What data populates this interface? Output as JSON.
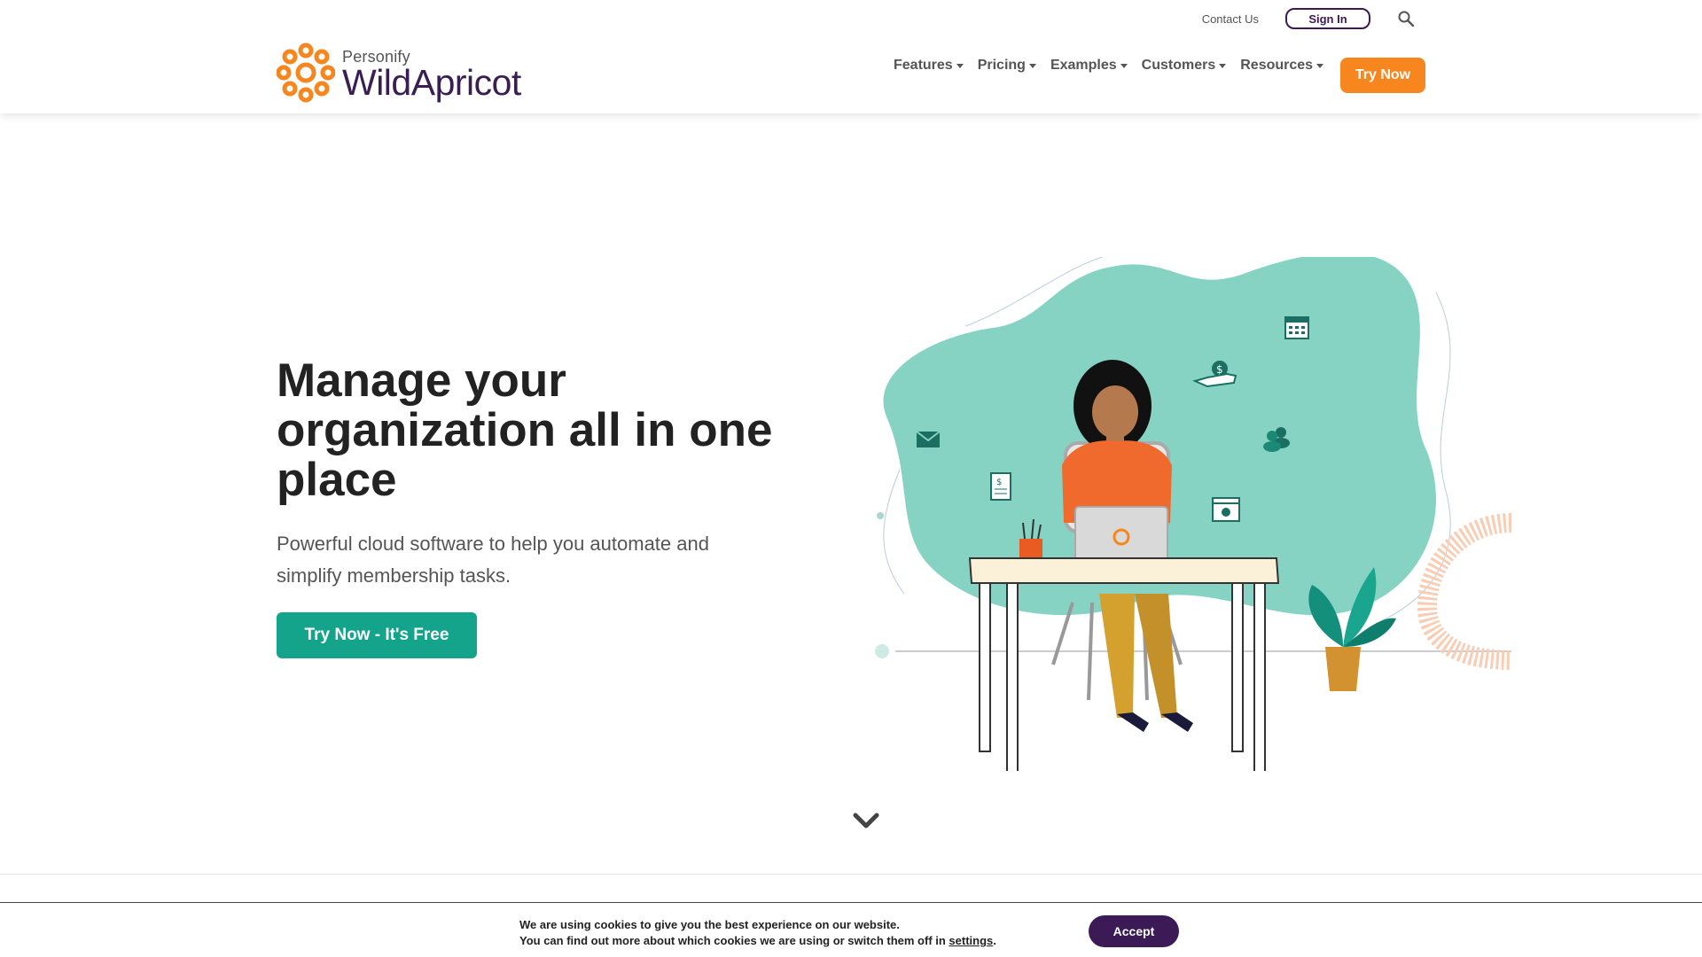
{
  "header": {
    "topbar": {
      "contact_label": "Contact Us",
      "signin_label": "Sign In",
      "search_icon": "search-icon"
    },
    "logo": {
      "personify": "Personify",
      "wordmark": "WildApricot"
    },
    "nav": {
      "items": [
        {
          "label": "Features"
        },
        {
          "label": "Pricing"
        },
        {
          "label": "Examples"
        },
        {
          "label": "Customers"
        },
        {
          "label": "Resources"
        }
      ],
      "cta_label": "Try Now"
    }
  },
  "hero": {
    "title": "Manage your organization all in one place",
    "subtitle": "Powerful cloud software to help you automate and simplify membership tasks.",
    "cta_label": "Try Now - It's Free"
  },
  "cookie": {
    "line1": "We are using cookies to give you the best experience on our website.",
    "line2_prefix": "You can find out more about which cookies we are using or switch them off in ",
    "settings_label": "settings",
    "line2_suffix": ".",
    "accept_label": "Accept"
  },
  "colors": {
    "brand_orange": "#f7861e",
    "brand_purple": "#3b1a55",
    "teal_cta": "#14a38b",
    "blob_teal": "#86d3c4"
  }
}
